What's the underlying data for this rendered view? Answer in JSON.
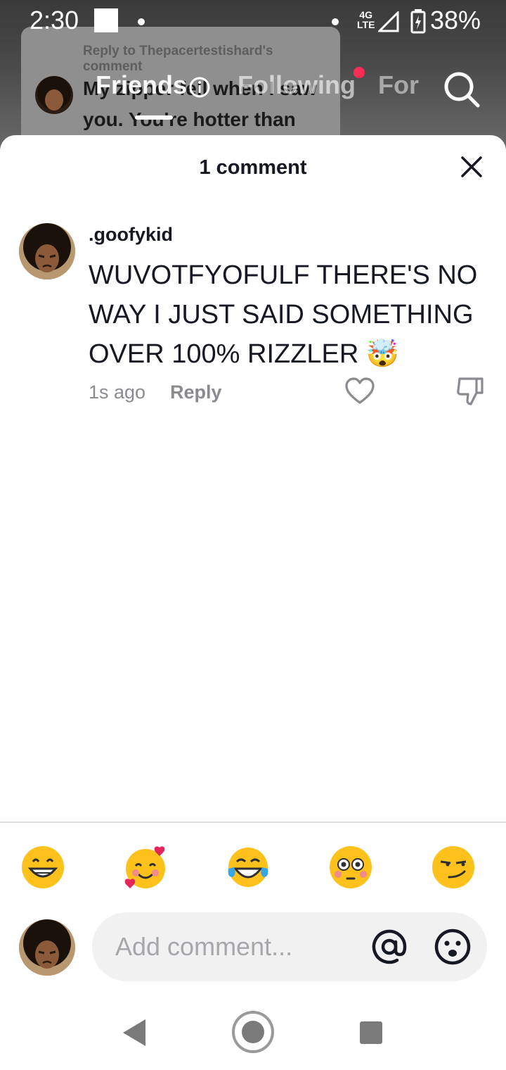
{
  "status_bar": {
    "time": "2:30",
    "network_top": "4G",
    "network_bottom": "LTE",
    "battery": "38%"
  },
  "background_video": {
    "reply_title": "Reply to Thepacertestishard's comment",
    "reply_text": "My zipper fell when I saw you. You're hotter than"
  },
  "top_nav": {
    "friends": "Friends",
    "following": "Following",
    "for_you": "For"
  },
  "sheet": {
    "title": "1 comment"
  },
  "comment": {
    "username": ".goofykid",
    "text": "WUVOTFYOFULF THERE'S NO WAY I JUST SAID SOMETHING OVER 100% RIZZLER 🤯",
    "time": "1s ago",
    "reply_label": "Reply"
  },
  "quick_emojis": [
    "grin",
    "smiling-hearts",
    "tears-of-joy",
    "flushed",
    "smirk"
  ],
  "composer": {
    "placeholder": "Add comment..."
  },
  "colors": {
    "accent_red": "#fe2c55",
    "text_primary": "#161823",
    "text_secondary": "#8a8b91",
    "input_bg": "#f1f1f2"
  }
}
